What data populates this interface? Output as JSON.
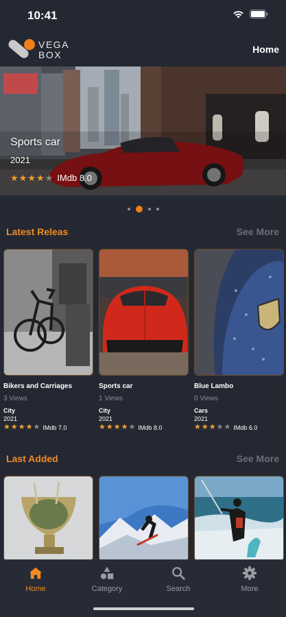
{
  "status_bar": {
    "time": "10:41",
    "wifi_icon": "wifi-icon",
    "battery_icon": "battery-icon"
  },
  "header": {
    "logo_line1": "VEGA",
    "logo_line2": "BOX",
    "home_label": "Home",
    "accent": "#f07f1a"
  },
  "hero": {
    "title": "Sports car",
    "year": "2021",
    "rating_stars": 4,
    "imdb": "IMdb 8.0"
  },
  "pager": {
    "count": 4,
    "active": 1
  },
  "latest": {
    "title": "Latest Releas",
    "see_more": "See More",
    "items": [
      {
        "title": "Bikers and Carriages",
        "views": "3 Views",
        "category": "City",
        "year": "2021",
        "stars": 4,
        "imdb": "IMdb 7.0"
      },
      {
        "title": "Sports car",
        "views": "1 Views",
        "category": "City",
        "year": "2021",
        "stars": 4,
        "imdb": "IMdb 8.0"
      },
      {
        "title": "Blue Lambo",
        "views": "0 Views",
        "category": "Cars",
        "year": "2021",
        "stars": 3,
        "imdb": "IMdb 6.0"
      }
    ]
  },
  "last_added": {
    "title": "Last Added",
    "see_more": "See More"
  },
  "nav": {
    "items": [
      {
        "label": "Home",
        "icon": "home-icon",
        "active": true
      },
      {
        "label": "Category",
        "icon": "category-icon",
        "active": false
      },
      {
        "label": "Search",
        "icon": "search-icon",
        "active": false
      },
      {
        "label": "More",
        "icon": "gear-icon",
        "active": false
      }
    ]
  }
}
